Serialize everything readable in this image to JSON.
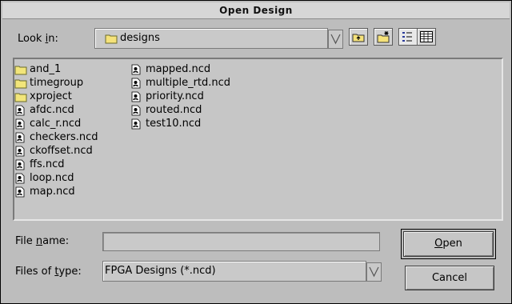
{
  "window": {
    "title": "Open Design"
  },
  "look_in": {
    "label_pre": "Look ",
    "label_mnemonic": "i",
    "label_post": "n:",
    "value": "designs",
    "folder_icon": "folder-icon"
  },
  "toolbar": {
    "up_folder": "up-one-level-icon",
    "new_folder": "new-folder-icon",
    "list_view": "list-view-icon",
    "details_view": "details-view-icon"
  },
  "files": {
    "column1": [
      {
        "name": "and_1",
        "type": "folder"
      },
      {
        "name": "timegroup",
        "type": "folder"
      },
      {
        "name": "xproject",
        "type": "folder"
      },
      {
        "name": "afdc.ncd",
        "type": "file"
      },
      {
        "name": "calc_r.ncd",
        "type": "file"
      },
      {
        "name": "checkers.ncd",
        "type": "file"
      },
      {
        "name": "ckoffset.ncd",
        "type": "file"
      },
      {
        "name": "ffs.ncd",
        "type": "file"
      },
      {
        "name": "loop.ncd",
        "type": "file"
      },
      {
        "name": "map.ncd",
        "type": "file"
      }
    ],
    "column2": [
      {
        "name": "mapped.ncd",
        "type": "file"
      },
      {
        "name": "multiple_rtd.ncd",
        "type": "file"
      },
      {
        "name": "priority.ncd",
        "type": "file"
      },
      {
        "name": "routed.ncd",
        "type": "file"
      },
      {
        "name": "test10.ncd",
        "type": "file"
      }
    ]
  },
  "file_name": {
    "label_pre": "File ",
    "label_mnemonic": "n",
    "label_post": "ame:",
    "value": ""
  },
  "file_type": {
    "label_pre": "Files of ",
    "label_mnemonic": "t",
    "label_post": "ype:",
    "value": "FPGA Designs (*.ncd)"
  },
  "buttons": {
    "open_mnemonic": "O",
    "open_rest": "pen",
    "cancel": "Cancel"
  }
}
